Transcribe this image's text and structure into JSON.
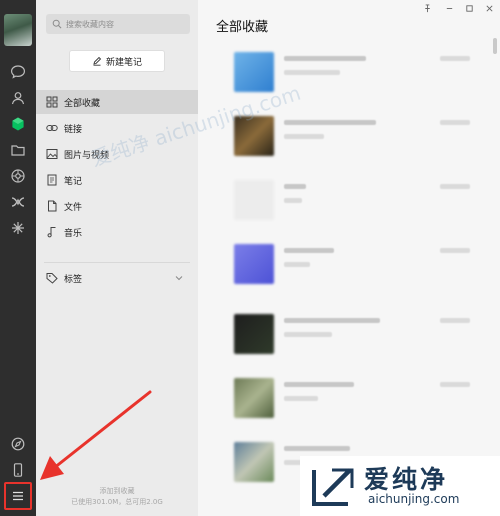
{
  "nav_rail": {
    "icons": [
      "chat-icon",
      "contacts-icon",
      "favorites-icon",
      "files-icon",
      "moments-icon",
      "mini-programs-icon",
      "channels-icon",
      "search-everything-icon",
      "phone-icon",
      "menu-icon"
    ]
  },
  "sidebar": {
    "search_placeholder": "搜索收藏内容",
    "new_note_label": "新建笔记",
    "items": [
      {
        "label": "全部收藏",
        "icon": "grid-icon",
        "active": true
      },
      {
        "label": "链接",
        "icon": "link-icon",
        "active": false
      },
      {
        "label": "图片与视频",
        "icon": "image-icon",
        "active": false
      },
      {
        "label": "笔记",
        "icon": "note-icon",
        "active": false
      },
      {
        "label": "文件",
        "icon": "file-icon",
        "active": false
      },
      {
        "label": "音乐",
        "icon": "music-icon",
        "active": false
      }
    ],
    "tags_label": "标签",
    "storage_title": "添加到收藏",
    "storage_usage": "已使用301.0M，总可用2.0G"
  },
  "main": {
    "title": "全部收藏",
    "window_controls": [
      "pin-icon",
      "minimize-icon",
      "maximize-icon",
      "close-icon"
    ]
  },
  "watermark": {
    "cn_text": "爱纯净",
    "en_text": "aichunjing.com",
    "ghost_text": "爱纯净 aichunjing.com"
  },
  "colors": {
    "rail_bg": "#2e2e2e",
    "sidebar_bg": "#ebebeb",
    "active_item_bg": "#d5d5d5",
    "favorites_green": "#07c160",
    "annotation_red": "#e8332c",
    "watermark_blue": "#1d3a58"
  }
}
